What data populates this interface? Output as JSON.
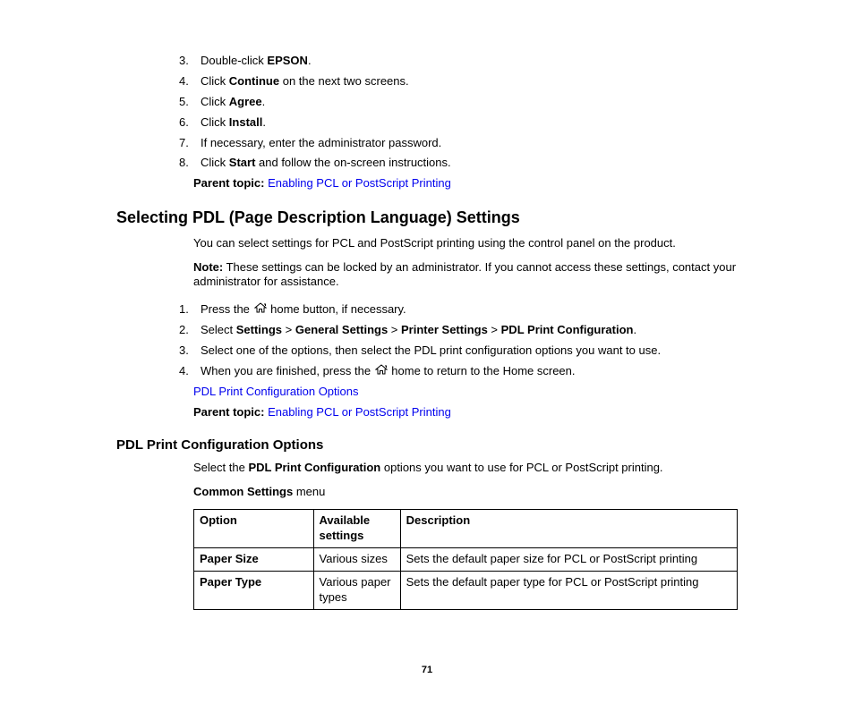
{
  "topSteps": [
    {
      "num": "3.",
      "pre": "Double-click ",
      "bold": "EPSON",
      "post": "."
    },
    {
      "num": "4.",
      "pre": "Click ",
      "bold": "Continue",
      "post": " on the next two screens."
    },
    {
      "num": "5.",
      "pre": "Click ",
      "bold": "Agree",
      "post": "."
    },
    {
      "num": "6.",
      "pre": "Click ",
      "bold": "Install",
      "post": "."
    },
    {
      "num": "7.",
      "pre": "If necessary, enter the administrator password.",
      "bold": "",
      "post": ""
    },
    {
      "num": "8.",
      "pre": "Click ",
      "bold": "Start",
      "post": " and follow the on-screen instructions."
    }
  ],
  "parentTopicLabel": "Parent topic:",
  "parentTopicLink1": "Enabling PCL or PostScript Printing",
  "h2": "Selecting PDL (Page Description Language) Settings",
  "intro": "You can select settings for PCL and PostScript printing using the control panel on the product.",
  "noteLabel": "Note:",
  "noteText": " These settings can be locked by an administrator. If you cannot access these settings, contact your administrator for assistance.",
  "midSteps": {
    "s1pre": "Press the ",
    "s1post": " home button, if necessary.",
    "s2pre": "Select ",
    "s2b1": "Settings",
    "s2b2": "General Settings",
    "s2b3": "Printer Settings",
    "s2b4": "PDL Print Configuration",
    "s3": "Select one of the options, then select the PDL print configuration options you want to use.",
    "s4pre": "When you are finished, press the ",
    "s4post": " home to return to the Home screen."
  },
  "link2": "PDL Print Configuration Options",
  "parentTopicLink2": "Enabling PCL or PostScript Printing",
  "h3": "PDL Print Configuration Options",
  "h3intro_pre": "Select the ",
  "h3intro_bold": "PDL Print Configuration",
  "h3intro_post": " options you want to use for PCL or PostScript printing.",
  "commonMenu_bold": "Common Settings",
  "commonMenu_post": " menu",
  "table": {
    "headers": [
      "Option",
      "Available settings",
      "Description"
    ],
    "rows": [
      [
        "Paper Size",
        "Various sizes",
        "Sets the default paper size for PCL or PostScript printing"
      ],
      [
        "Paper Type",
        "Various paper types",
        "Sets the default paper type for PCL or PostScript printing"
      ]
    ]
  },
  "pageNumber": "71"
}
